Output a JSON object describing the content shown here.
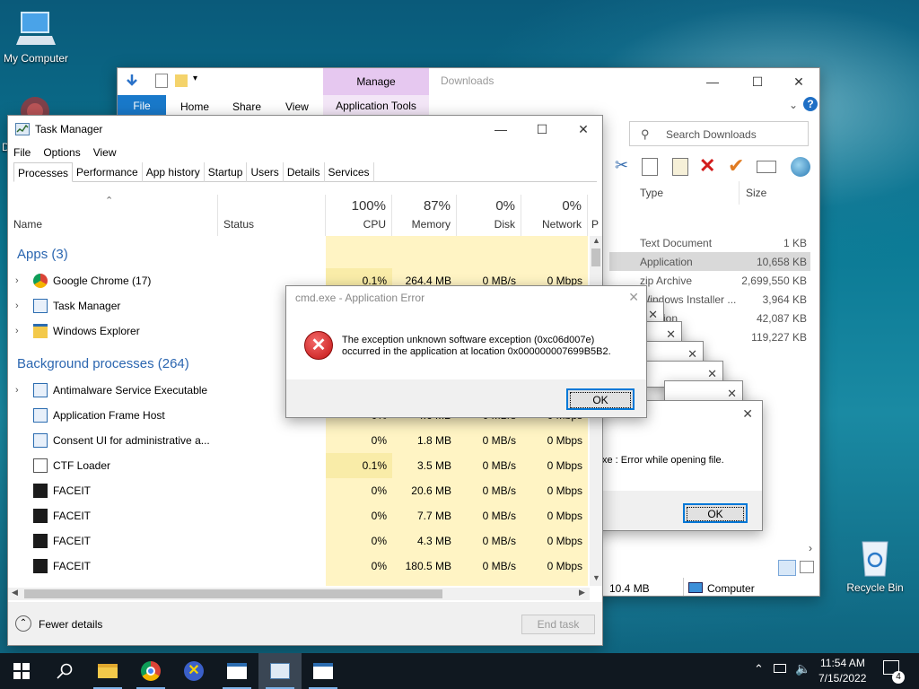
{
  "desktop": {
    "icons": [
      {
        "label": "My Computer"
      },
      {
        "label": "Recycle Bin"
      }
    ],
    "partial_label": "D"
  },
  "explorer": {
    "manage_tab": "Manage",
    "window_title": "Downloads",
    "tabs": [
      "File",
      "Home",
      "Share",
      "View"
    ],
    "context_tab": "Application Tools",
    "search_placeholder": "Search Downloads",
    "columns": {
      "type": "Type",
      "size": "Size"
    },
    "rows": [
      {
        "type": "Text Document",
        "size": "1 KB"
      },
      {
        "type": "Application",
        "size": "10,658 KB"
      },
      {
        "type": "zip Archive",
        "size": "2,699,550 KB"
      },
      {
        "type": "Windows Installer ...",
        "size": "3,964 KB"
      },
      {
        "type": "...cation",
        "size": "42,087 KB"
      },
      {
        "type": "...on",
        "size": "119,227 KB"
      }
    ],
    "status_size": "10.4 MB",
    "status_location": "Computer"
  },
  "taskmgr": {
    "title": "Task Manager",
    "menu": [
      "File",
      "Options",
      "View"
    ],
    "tabs": [
      "Processes",
      "Performance",
      "App history",
      "Startup",
      "Users",
      "Details",
      "Services"
    ],
    "columns": {
      "name": "Name",
      "status": "Status",
      "cpu_pct": "100%",
      "cpu": "CPU",
      "mem_pct": "87%",
      "mem": "Memory",
      "disk_pct": "0%",
      "disk": "Disk",
      "net_pct": "0%",
      "net": "Network",
      "extra": "P"
    },
    "apps_header": "Apps (3)",
    "apps": [
      {
        "name": "Google Chrome (17)",
        "cpu": "0.1%",
        "mem": "264.4 MB",
        "disk": "0 MB/s",
        "net": "0 Mbps"
      },
      {
        "name": "Task Manager",
        "cpu": "",
        "mem": "",
        "disk": "",
        "net": ""
      },
      {
        "name": "Windows Explorer",
        "cpu": "",
        "mem": "",
        "disk": "",
        "net": ""
      }
    ],
    "bg_header": "Background processes (264)",
    "bg": [
      {
        "name": "Antimalware Service Executable",
        "cpu": "",
        "mem": "",
        "disk": "",
        "net": ""
      },
      {
        "name": "Application Frame Host",
        "cpu": "0%",
        "mem": "4.6 MB",
        "disk": "0 MB/s",
        "net": "0 Mbps"
      },
      {
        "name": "Consent UI for administrative a...",
        "cpu": "0%",
        "mem": "1.8 MB",
        "disk": "0 MB/s",
        "net": "0 Mbps"
      },
      {
        "name": "CTF Loader",
        "cpu": "0.1%",
        "mem": "3.5 MB",
        "disk": "0 MB/s",
        "net": "0 Mbps"
      },
      {
        "name": "FACEIT",
        "cpu": "0%",
        "mem": "20.6 MB",
        "disk": "0 MB/s",
        "net": "0 Mbps"
      },
      {
        "name": "FACEIT",
        "cpu": "0%",
        "mem": "7.7 MB",
        "disk": "0 MB/s",
        "net": "0 Mbps"
      },
      {
        "name": "FACEIT",
        "cpu": "0%",
        "mem": "4.3 MB",
        "disk": "0 MB/s",
        "net": "0 Mbps"
      },
      {
        "name": "FACEIT",
        "cpu": "0%",
        "mem": "180.5 MB",
        "disk": "0 MB/s",
        "net": "0 Mbps"
      }
    ],
    "fewer_details": "Fewer details",
    "end_task": "End task"
  },
  "error_dialog": {
    "title": "cmd.exe - Application Error",
    "message_line1": "The exception unknown software exception (0xc06d007e)",
    "message_line2": "occurred in the application at location 0x000000007699B5B2.",
    "ok": "OK"
  },
  "second_dialog": {
    "message": "xe : Error while opening file.",
    "ok": "OK"
  },
  "taskbar": {
    "time": "11:54 AM",
    "date": "7/15/2022",
    "notifications": "4"
  }
}
